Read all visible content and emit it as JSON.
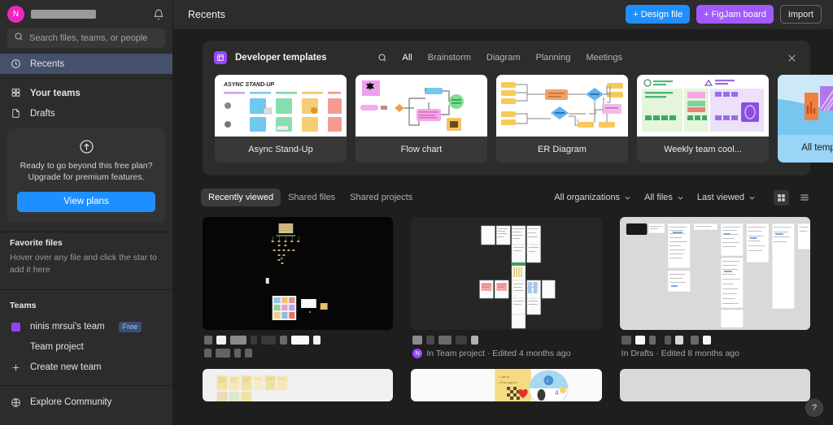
{
  "sidebar": {
    "account": {
      "avatar_initial": "N",
      "name_redacted": true
    },
    "notification_icon": "bell-icon",
    "search": {
      "placeholder": "Search files, teams, or people",
      "value": ""
    },
    "nav": [
      {
        "label": "Recents",
        "icon": "clock-icon",
        "active": true
      },
      {
        "label": "Your teams",
        "icon": "teams-icon",
        "active": false
      },
      {
        "label": "Drafts",
        "icon": "file-icon",
        "active": false
      }
    ],
    "upsell": {
      "icon": "arrow-up-circle-icon",
      "line1": "Ready to go beyond this free plan?",
      "line2": "Upgrade for premium features.",
      "button_label": "View plans"
    },
    "favorites": {
      "title": "Favorite files",
      "empty_text": "Hover over any file and click the star to add it here"
    },
    "teams": {
      "title": "Teams",
      "items": [
        {
          "label": "ninis mrsui's team",
          "badge": "Free",
          "swatch_color": "#9747ff"
        },
        {
          "label": "Team project",
          "badge": "",
          "swatch_color": ""
        }
      ],
      "create_label": "Create new team",
      "create_icon": "plus-icon"
    },
    "explore": {
      "label": "Explore Community",
      "icon": "globe-icon"
    }
  },
  "header": {
    "title": "Recents",
    "buttons": [
      {
        "label": "+ Design file",
        "name": "design-file-button",
        "color": "#1e8fff"
      },
      {
        "label": "+ FigJam board",
        "name": "figjam-board-button",
        "color": "#a259ff"
      },
      {
        "label": "Import",
        "name": "import-button",
        "color": ""
      }
    ]
  },
  "templates": {
    "icon": "templates-icon",
    "title": "Developer templates",
    "search_icon": "search-icon",
    "close_icon": "close-icon",
    "tabs": [
      {
        "label": "All",
        "selected": true
      },
      {
        "label": "Brainstorm",
        "selected": false
      },
      {
        "label": "Diagram",
        "selected": false
      },
      {
        "label": "Planning",
        "selected": false
      },
      {
        "label": "Meetings",
        "selected": false
      }
    ],
    "cards": [
      {
        "label": "Async Stand-Up",
        "thumb": "async-standup-thumb"
      },
      {
        "label": "Flow chart",
        "thumb": "flowchart-thumb"
      },
      {
        "label": "ER Diagram",
        "thumb": "er-diagram-thumb"
      },
      {
        "label": "Weekly team cool...",
        "thumb": "weekly-team-thumb"
      }
    ],
    "all_templates": {
      "label": "All templates →",
      "bg_color": "#9ad5f5"
    }
  },
  "filters": {
    "chips": [
      {
        "label": "Recently viewed",
        "selected": true
      },
      {
        "label": "Shared files",
        "selected": false
      },
      {
        "label": "Shared projects",
        "selected": false
      }
    ],
    "selects": [
      {
        "label": "All organizations",
        "name": "organizations-select"
      },
      {
        "label": "All files",
        "name": "files-select"
      },
      {
        "label": "Last viewed",
        "name": "sort-select"
      }
    ],
    "view_grid_icon": "grid-view-icon",
    "view_list_icon": "list-view-icon",
    "active_view": "grid"
  },
  "files": [
    {
      "name_redacted": true,
      "thumb": "dark-canvas-thumb",
      "thumb_bg": "#060606",
      "meta": "",
      "meta_avatar": "",
      "extra_redact_row": true
    },
    {
      "name_redacted": true,
      "thumb": "wireframe-grid-thumb",
      "thumb_bg": "#262626",
      "meta": "In Team project · Edited 4 months ago",
      "meta_avatar": "N",
      "extra_redact_row": false
    },
    {
      "name_redacted": true,
      "thumb": "light-wireframes-thumb",
      "thumb_bg": "#d9d9d9",
      "meta": "In Drafts · Edited 8 months ago",
      "meta_avatar": "",
      "extra_redact_row": false
    }
  ],
  "files_row2": [
    {
      "thumb": "sticky-notes-thumb",
      "thumb_bg": "#f0f0f0"
    },
    {
      "thumb": "moodboard-thumb",
      "thumb_bg": "#fafafa"
    },
    {
      "thumb": "blank-thumb",
      "thumb_bg": "#d9d9d9"
    }
  ],
  "help": {
    "label": "?",
    "name": "help-button"
  },
  "colors": {
    "accent_blue": "#1e8fff",
    "accent_purple": "#a259ff",
    "avatar_pink": "#ef26c0",
    "sidebar_bg": "#2c2c2c",
    "main_bg": "#1e1e1e",
    "active_nav": "#45506b"
  }
}
